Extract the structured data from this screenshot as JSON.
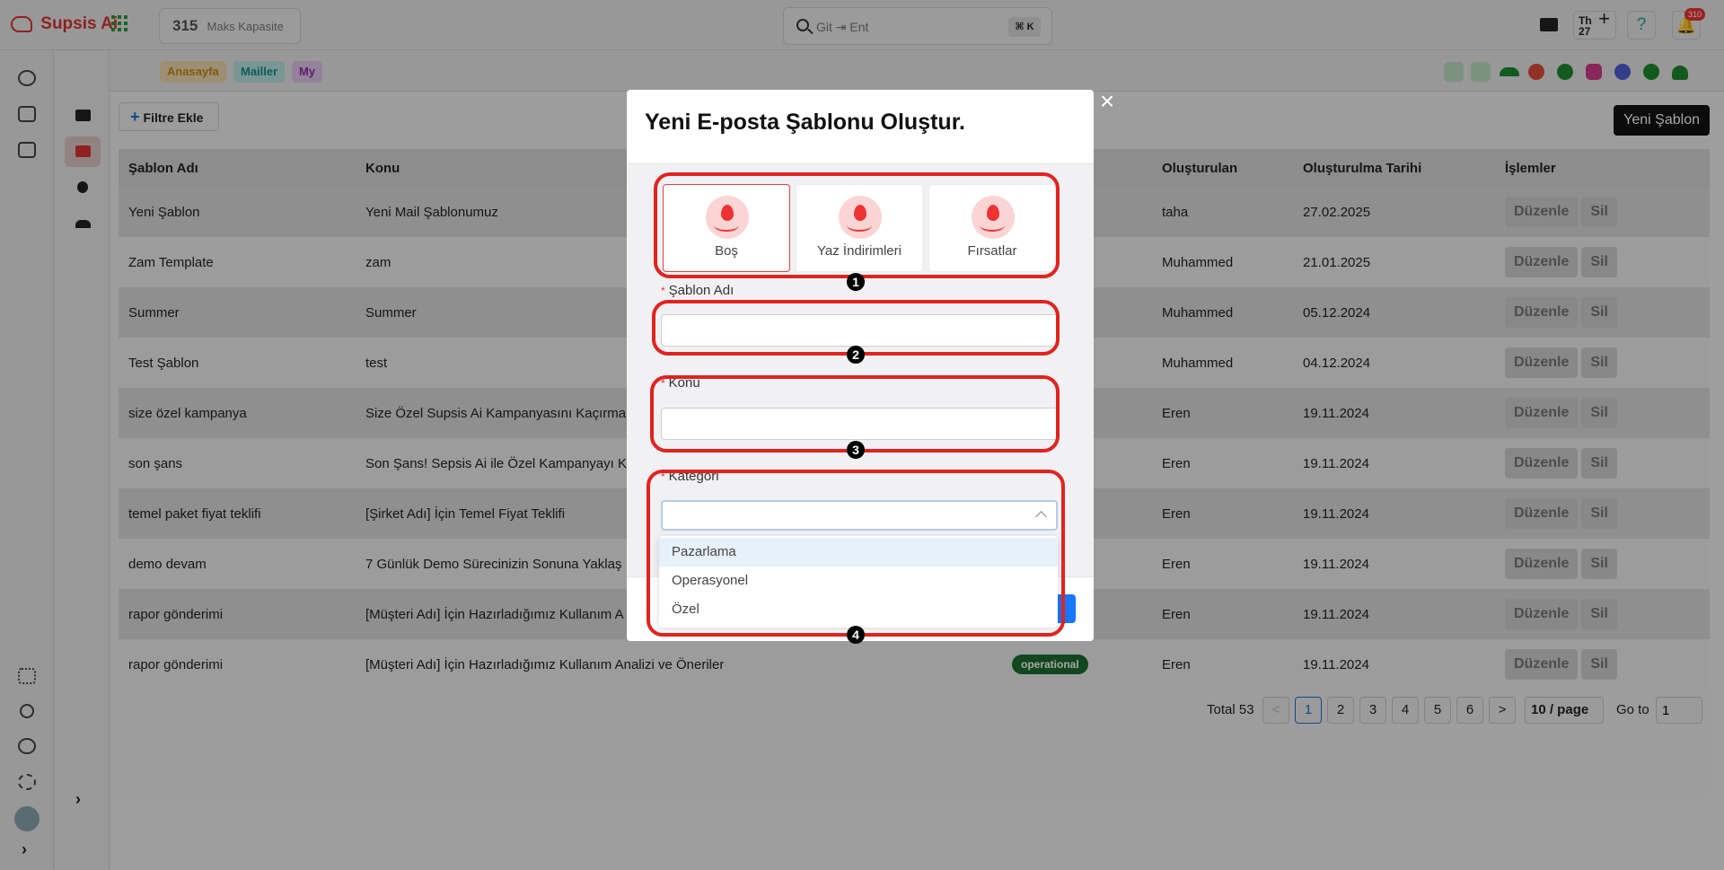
{
  "brand": {
    "name": "Supsis Ai"
  },
  "capacity": {
    "value": "315",
    "label": "Maks Kapasite"
  },
  "search": {
    "value": "Git ⇥ Ent",
    "shortcut": "⌘ K"
  },
  "header_right": {
    "calendar_day": "Th",
    "calendar_date": "27",
    "calendar_plus": "+",
    "help": "?",
    "notification_count": "310"
  },
  "tags": [
    {
      "label": "Anasayfa",
      "bg": "#f2dcb1",
      "color": "#c98a1a"
    },
    {
      "label": "Mailler",
      "bg": "#b7e6e4",
      "color": "#1a8f8a"
    },
    {
      "label": "My",
      "bg": "#e4c6ee",
      "color": "#8a2ea8"
    }
  ],
  "toolbar": {
    "filter_label": "Filtre Ekle",
    "new_template_label": "Yeni Şablon"
  },
  "table": {
    "headers": [
      "Şablon Adı",
      "Konu",
      "",
      "Oluşturulan",
      "Oluşturulma Tarihi",
      "İşlemler"
    ],
    "rows": [
      {
        "name": "Yeni Şablon",
        "subject": "Yeni Mail Şablonumuz",
        "badge": "",
        "creator": "taha",
        "date": "27.02.2025"
      },
      {
        "name": "Zam Template",
        "subject": "zam",
        "badge": "",
        "creator": "Muhammed",
        "date": "21.01.2025"
      },
      {
        "name": "Summer",
        "subject": "Summer",
        "badge": "",
        "creator": "Muhammed",
        "date": "05.12.2024"
      },
      {
        "name": "Test Şablon",
        "subject": "test",
        "badge": "",
        "creator": "Muhammed",
        "date": "04.12.2024"
      },
      {
        "name": "size özel kampanya",
        "subject": "Size Özel Supsis Ai Kampanyasını Kaçırma",
        "badge": "",
        "creator": "Eren",
        "date": "19.11.2024"
      },
      {
        "name": "son şans",
        "subject": "Son Şans! Sepsis Ai ile Özel Kampanyayı K",
        "badge": "",
        "creator": "Eren",
        "date": "19.11.2024"
      },
      {
        "name": "temel paket fiyat teklifi",
        "subject": "[Şirket Adı] İçin Temel Fiyat Teklifi",
        "badge": "",
        "creator": "Eren",
        "date": "19.11.2024"
      },
      {
        "name": "demo devam",
        "subject": "7 Günlük Demo Sürecinizin Sonuna Yaklaş",
        "badge": "",
        "creator": "Eren",
        "date": "19.11.2024"
      },
      {
        "name": "rapor gönderimi",
        "subject": "[Müşteri Adı] İçin Hazırladığımız Kullanım A",
        "badge": "",
        "creator": "Eren",
        "date": "19.11.2024"
      },
      {
        "name": "rapor gönderimi",
        "subject": "[Müşteri Adı] İçin Hazırladığımız Kullanım Analizi ve Öneriler",
        "badge": "operational",
        "creator": "Eren",
        "date": "19.11.2024"
      }
    ],
    "edit_label": "Düzenle",
    "delete_label": "Sil"
  },
  "pagination": {
    "total": "Total 53",
    "prev": "<",
    "pages": [
      "1",
      "2",
      "3",
      "4",
      "5",
      "6"
    ],
    "next": ">",
    "per_page": "10 / page",
    "goto_label": "Go to",
    "goto_value": "1"
  },
  "modal": {
    "title": "Yeni E-posta Şablonu Oluştur.",
    "close": "×",
    "template_types": [
      "Boş",
      "Yaz İndirimleri",
      "Fırsatlar"
    ],
    "name_label": "Şablon Adı",
    "subject_label": "Konu",
    "category_label": "Kategori",
    "required_mark": "*",
    "category_options": [
      "Pazarlama",
      "Operasyonel",
      "Özel"
    ]
  },
  "markers": [
    "1",
    "2",
    "3",
    "4"
  ]
}
